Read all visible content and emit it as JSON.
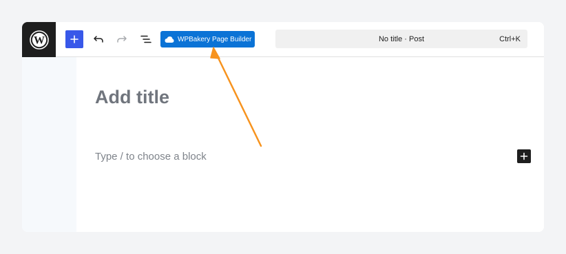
{
  "toolbar": {
    "logo_icon": "wordpress-logo-icon",
    "add_block_icon": "plus-icon",
    "undo_icon": "undo-icon",
    "redo_icon": "redo-icon",
    "list_view_icon": "list-view-icon",
    "page_builder_button": {
      "label": "WPBakery Page Builder",
      "icon": "wpbakery-cloud-icon"
    },
    "command_bar": {
      "title": "No title · Post",
      "shortcut": "Ctrl+K"
    }
  },
  "editor": {
    "title_placeholder": "Add title",
    "block_placeholder": "Type / to choose a block",
    "inserter_icon": "plus-icon"
  },
  "annotation": {
    "arrow_color": "#f7931e"
  },
  "colors": {
    "accent": "#3858e9",
    "wpbakery_blue": "#0b73d6",
    "dark": "#1e1e1e",
    "page_background": "#f3f4f6"
  }
}
